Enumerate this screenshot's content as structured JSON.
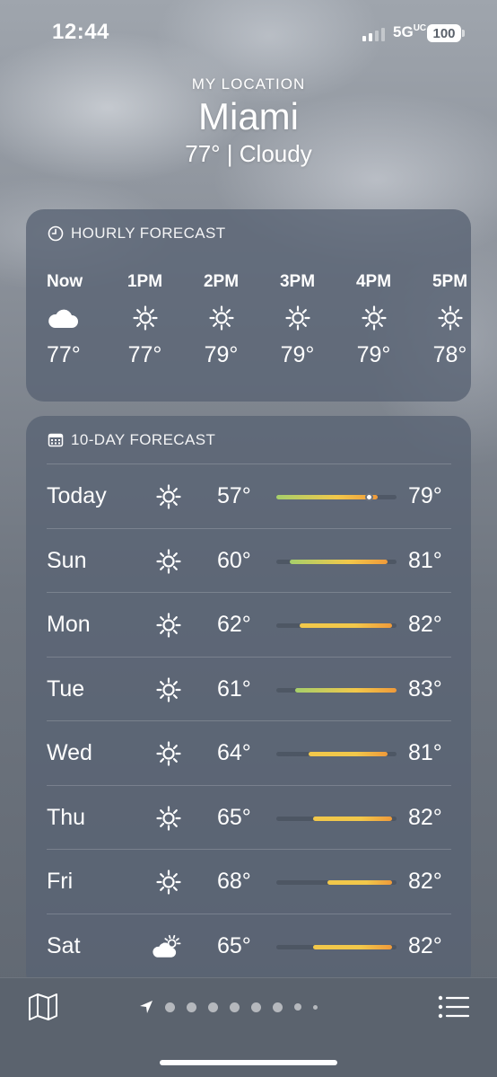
{
  "status": {
    "time": "12:44",
    "network": "5GUC",
    "battery": "100"
  },
  "header": {
    "location_label": "MY LOCATION",
    "city": "Miami",
    "summary": "77° | Cloudy"
  },
  "hourly": {
    "title": "HOURLY FORECAST",
    "hours": [
      {
        "label": "Now",
        "icon": "cloud-icon",
        "temp": "77°"
      },
      {
        "label": "1PM",
        "icon": "sun-icon",
        "temp": "77°"
      },
      {
        "label": "2PM",
        "icon": "sun-icon",
        "temp": "79°"
      },
      {
        "label": "3PM",
        "icon": "sun-icon",
        "temp": "79°"
      },
      {
        "label": "4PM",
        "icon": "sun-icon",
        "temp": "79°"
      },
      {
        "label": "5PM",
        "icon": "sun-icon",
        "temp": "78°"
      }
    ]
  },
  "tenday": {
    "title": "10-DAY FORECAST",
    "range_min": 57,
    "range_max": 83,
    "current_temp": 77,
    "days": [
      {
        "name": "Today",
        "icon": "sun-icon",
        "low": "57°",
        "high": "79°",
        "low_value": 57,
        "high_value": 79
      },
      {
        "name": "Sun",
        "icon": "sun-icon",
        "low": "60°",
        "high": "81°",
        "low_value": 60,
        "high_value": 81
      },
      {
        "name": "Mon",
        "icon": "sun-icon",
        "low": "62°",
        "high": "82°",
        "low_value": 62,
        "high_value": 82
      },
      {
        "name": "Tue",
        "icon": "sun-icon",
        "low": "61°",
        "high": "83°",
        "low_value": 61,
        "high_value": 83
      },
      {
        "name": "Wed",
        "icon": "sun-icon",
        "low": "64°",
        "high": "81°",
        "low_value": 64,
        "high_value": 81
      },
      {
        "name": "Thu",
        "icon": "sun-icon",
        "low": "65°",
        "high": "82°",
        "low_value": 65,
        "high_value": 82
      },
      {
        "name": "Fri",
        "icon": "sun-icon",
        "low": "68°",
        "high": "82°",
        "low_value": 68,
        "high_value": 82
      },
      {
        "name": "Sat",
        "icon": "partly-cloudy-icon",
        "low": "65°",
        "high": "82°",
        "low_value": 65,
        "high_value": 82
      }
    ]
  },
  "bottom": {
    "page_count": 9,
    "active_page": 0
  },
  "colors": {
    "cool": "#a6cf6b",
    "warm": "#f2c84a",
    "hot": "#ef9a3a",
    "card": "#58637380"
  }
}
